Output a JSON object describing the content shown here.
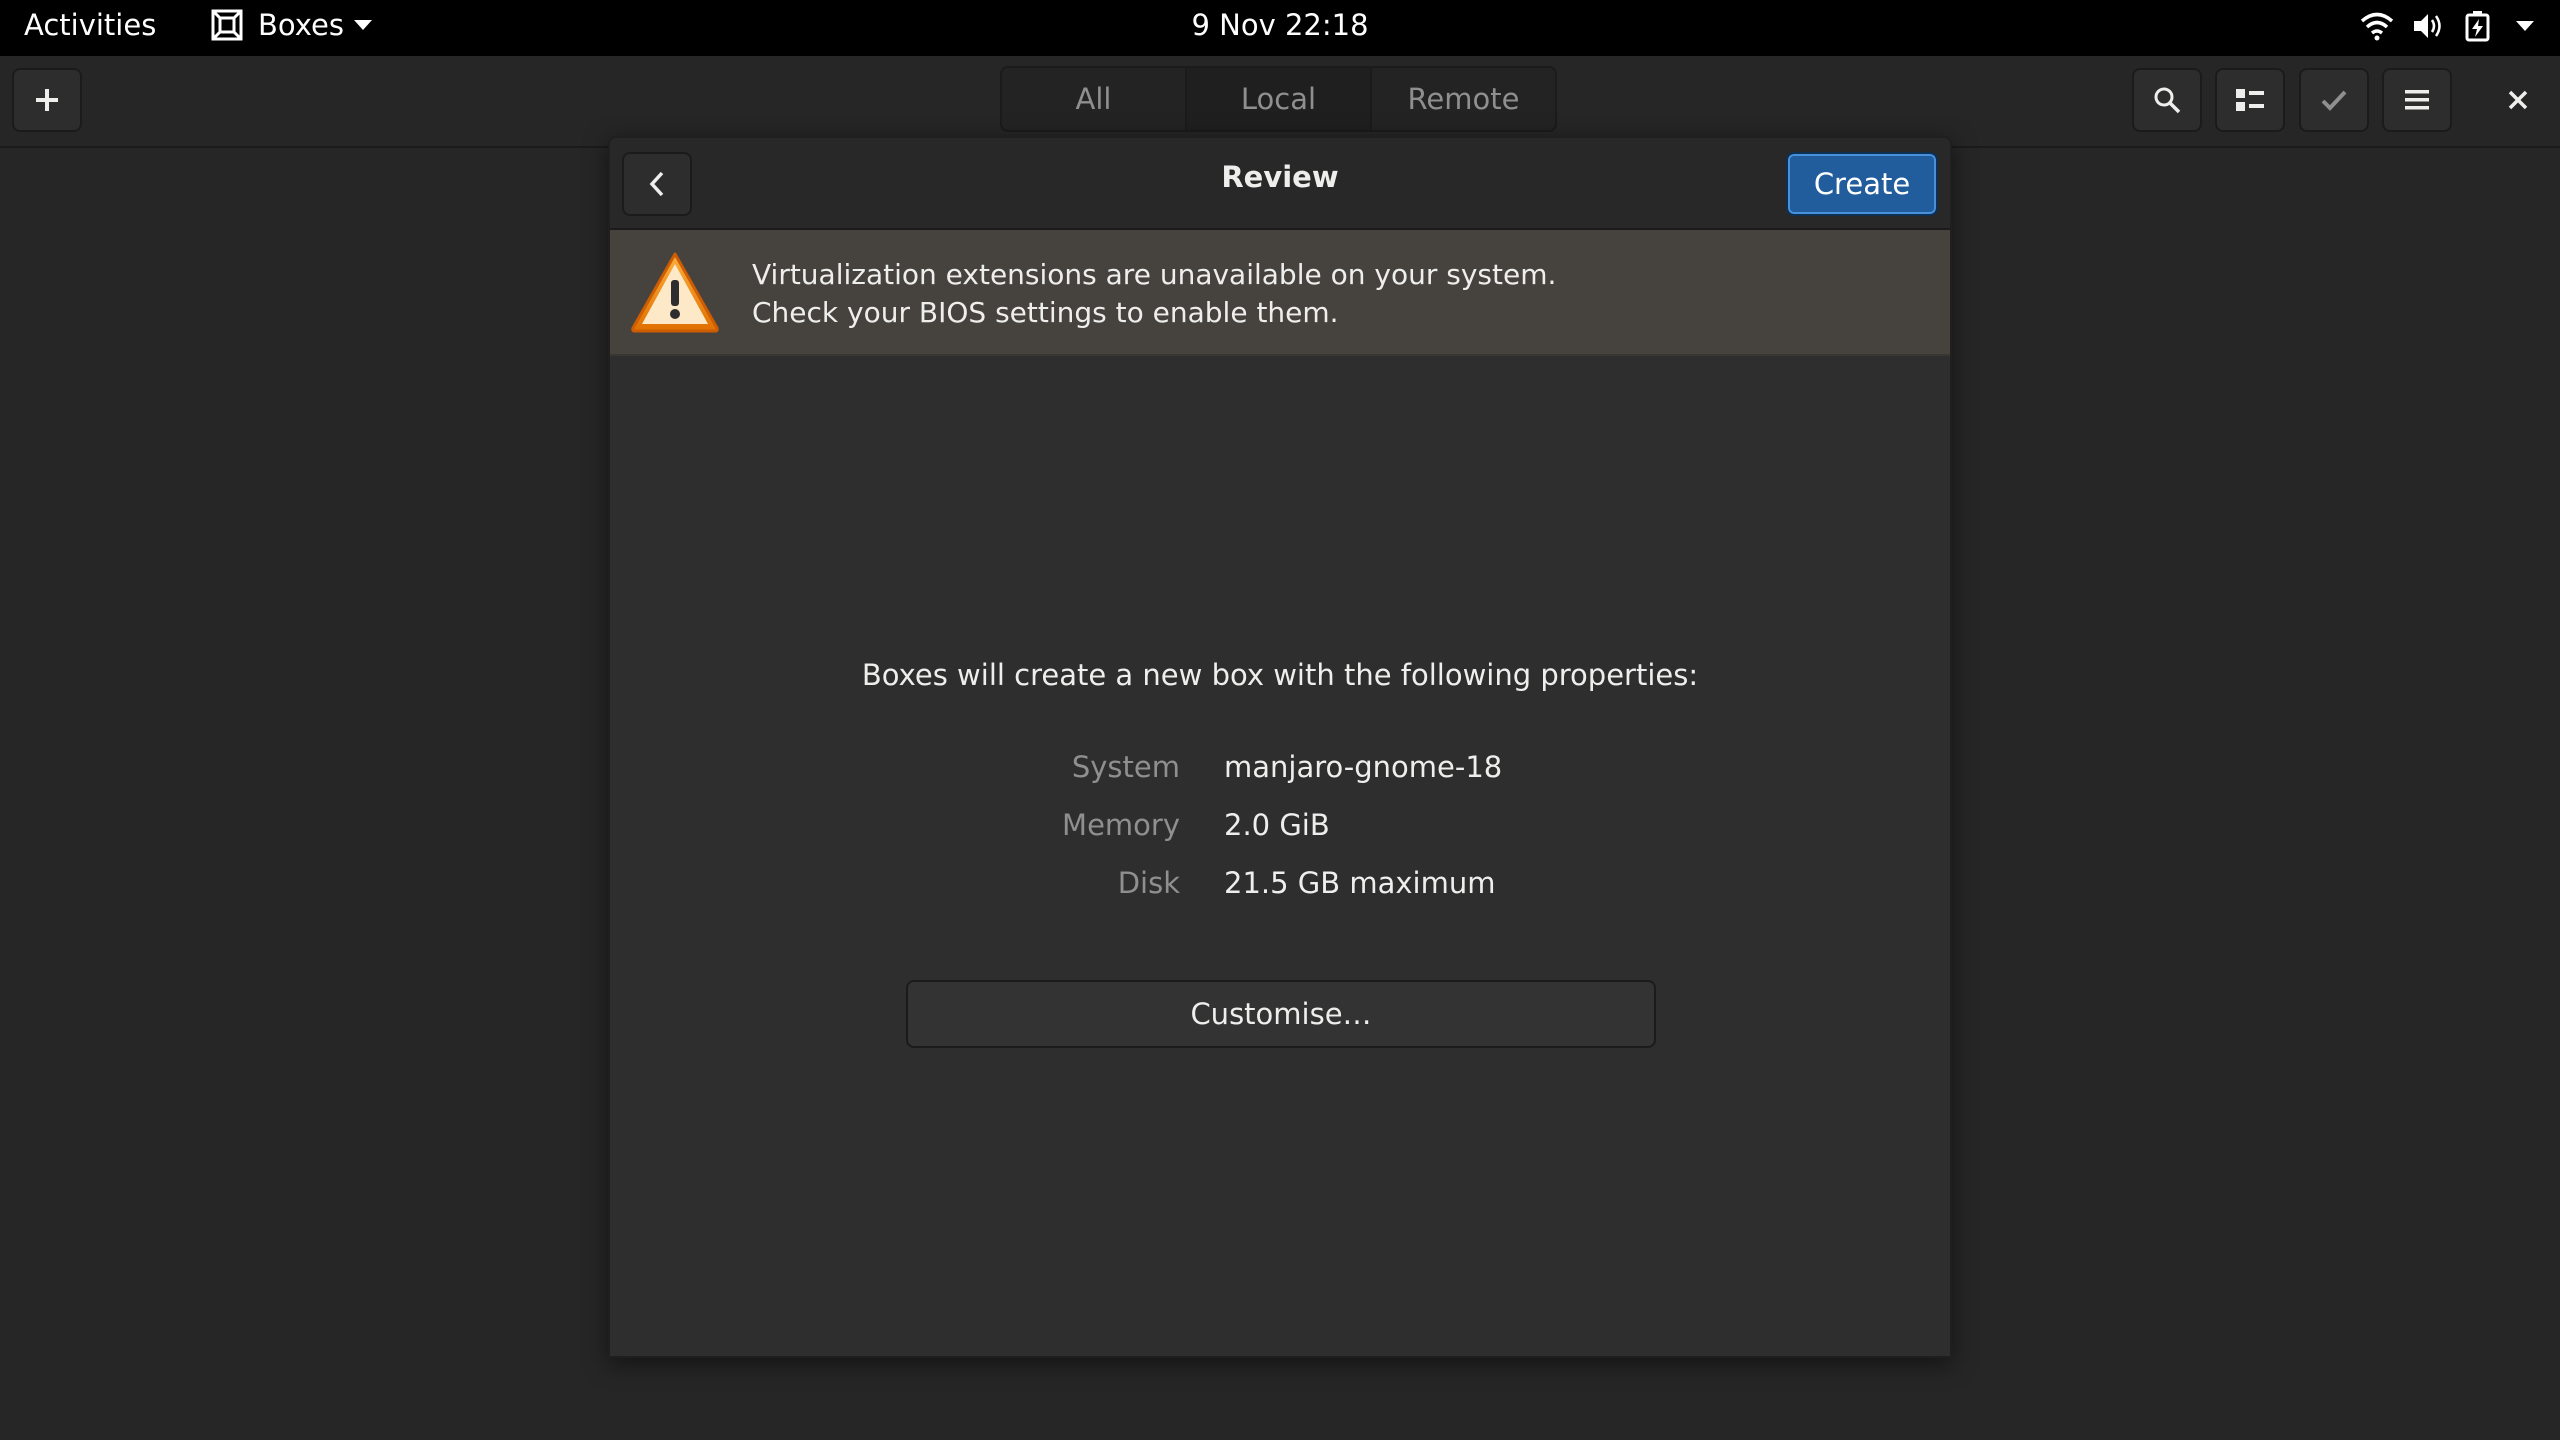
{
  "topbar": {
    "activities": "Activities",
    "app_name": "Boxes",
    "app_icon": "boxes-app-icon",
    "clock": "9 Nov  22:18",
    "status_icons": [
      "wifi-icon",
      "volume-icon",
      "battery-icon"
    ]
  },
  "header": {
    "new_button_icon": "plus-icon",
    "tabs": [
      {
        "label": "All"
      },
      {
        "label": "Local"
      },
      {
        "label": "Remote"
      }
    ],
    "search_icon": "search-icon",
    "view_icon": "list-view-icon",
    "select_icon": "checkmark-icon",
    "menu_icon": "hamburger-menu-icon",
    "close_icon": "close-icon"
  },
  "dialog": {
    "title": "Review",
    "create_label": "Create",
    "back_icon": "chevron-left-icon",
    "warning": {
      "icon": "warning-icon",
      "line1": "Virtualization extensions are unavailable on your system.",
      "line2": "Check your BIOS settings to enable them."
    },
    "summary": "Boxes will create a new box with the following properties:",
    "properties": [
      {
        "label": "System",
        "value": "manjaro-gnome-18"
      },
      {
        "label": "Memory",
        "value": "2.0 GiB"
      },
      {
        "label": "Disk",
        "value": "21.5 GB maximum"
      }
    ],
    "customise_label": "Customise…"
  },
  "colors": {
    "accent": "#215d9c",
    "infobar_bg": "#46433f",
    "warning_orange": "#f57900"
  }
}
